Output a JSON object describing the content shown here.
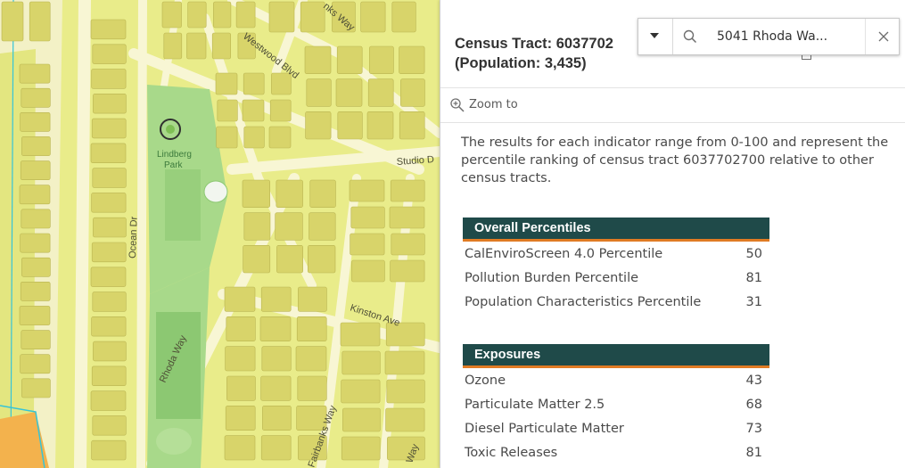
{
  "map": {
    "streets": [
      "Westwood Blvd",
      "Ocean Dr",
      "Rhoda Way",
      "Kinston Ave",
      "Fairbanks Way",
      "Studio D",
      "nks Way",
      "Way",
      "Bl"
    ],
    "park": {
      "name_line1": "Lindberg",
      "name_line2": "Park"
    },
    "colors": {
      "land": "#e9ec8a",
      "roads": "#f8f6d4",
      "buildings": "#d8d46a",
      "building_edge": "#b9b350",
      "park": "#a8d98a",
      "park_dark": "#8cc872",
      "orange_zone": "#f3b24d",
      "water_line": "#35c4d8"
    }
  },
  "search": {
    "value": "5041 Rhoda Wa...",
    "icon": "search-icon",
    "clear_icon": "close-icon",
    "dropdown_icon": "caret-down-icon"
  },
  "popup": {
    "title_line1": "Census Tract: 6037702",
    "title_line2": "(Population: 3,435)",
    "zoom_label": "Zoom to",
    "intro": "The results for each indicator range from 0-100 and represent the percentile ranking of census tract 6037702700 relative to other census tracts.",
    "sections": [
      {
        "heading": "Overall Percentiles",
        "rows": [
          {
            "label": "CalEnviroScreen 4.0 Percentile",
            "value": "50"
          },
          {
            "label": "Pollution Burden Percentile",
            "value": "81"
          },
          {
            "label": "Population Characteristics Percentile",
            "value": "31"
          }
        ]
      },
      {
        "heading": "Exposures",
        "rows": [
          {
            "label": "Ozone",
            "value": "43"
          },
          {
            "label": "Particulate Matter 2.5",
            "value": "68"
          },
          {
            "label": "Diesel Particulate Matter",
            "value": "73"
          },
          {
            "label": "Toxic Releases",
            "value": "81"
          }
        ]
      }
    ],
    "colors": {
      "section_bg": "#1f4a49",
      "section_accent": "#e07b24"
    }
  }
}
